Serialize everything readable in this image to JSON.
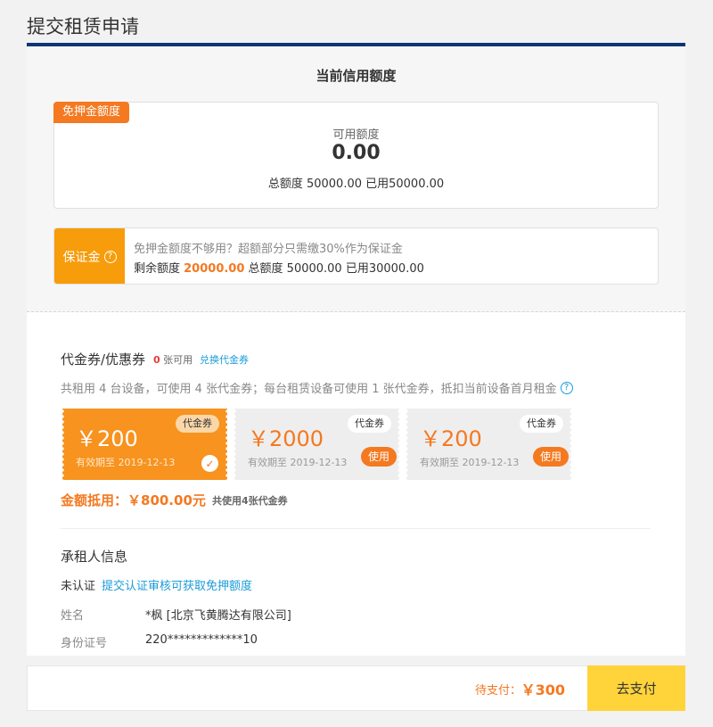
{
  "page": {
    "title": "提交租赁申请"
  },
  "credit": {
    "heading": "当前信用额度",
    "quota_tag": "免押金额度",
    "available_label": "可用额度",
    "available_value": "0.00",
    "total_line": "总额度 50000.00 已用50000.00"
  },
  "deposit": {
    "tag": "保证金",
    "line1": "免押金额度不够用？超额部分只需缴30%作为保证金",
    "line2_prefix": "剩余额度 ",
    "remaining": "20000.00",
    "line2_suffix": " 总额度 50000.00 已用30000.00"
  },
  "coupons": {
    "title": "代金券/优惠券",
    "available_count": "0",
    "available_suffix": " 张可用",
    "swap_link": "兑换代金券",
    "note": "共租用 4 台设备，可使用 4 张代金券；每台租赁设备可使用 1 张代金券，抵扣当前设备首月租金",
    "items": [
      {
        "amount": "￥200",
        "type": "代金券",
        "expire": "有效期至 2019-12-13",
        "selected": true
      },
      {
        "amount": "￥2000",
        "type": "代金券",
        "expire": "有效期至 2019-12-13",
        "use_label": "使用"
      },
      {
        "amount": "￥200",
        "type": "代金券",
        "expire": "有效期至 2019-12-13",
        "use_label": "使用"
      }
    ],
    "deduct_label": "金额抵用：￥800.00元",
    "deduct_note": "共使用4张代金券"
  },
  "lessee": {
    "title": "承租人信息",
    "status": "未认证",
    "verify_link": "提交认证审核可获取免押额度",
    "name_label": "姓名",
    "name_value": "*枫 [北京飞黄腾达有限公司]",
    "id_label": "身份证号",
    "id_value": "220*************10"
  },
  "footer": {
    "pay_label": "待支付：",
    "pay_amount": "￥300",
    "pay_button": "去支付"
  },
  "colors": {
    "accent": "#f47920",
    "deposit": "#f79c0b",
    "title_bar": "#0c3575",
    "link": "#1a9cd8",
    "pay_button": "#ffd43b"
  }
}
